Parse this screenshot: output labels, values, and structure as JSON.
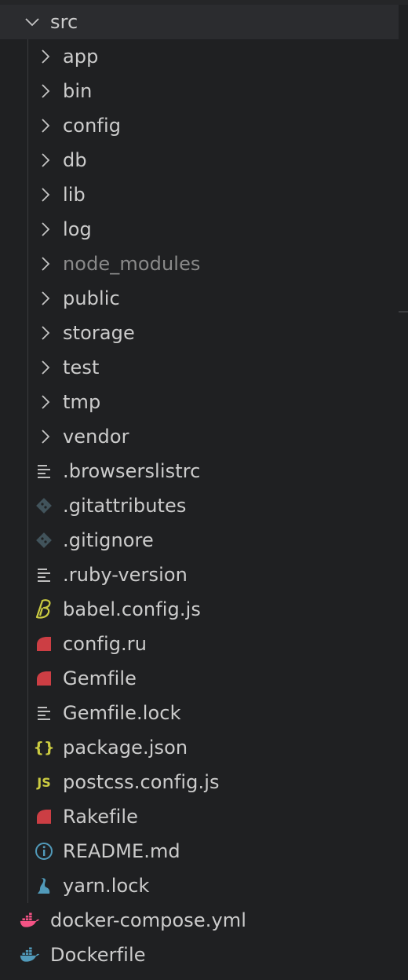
{
  "root": {
    "label": "src",
    "expanded": true
  },
  "folders": [
    {
      "label": "app",
      "dim": false
    },
    {
      "label": "bin",
      "dim": false
    },
    {
      "label": "config",
      "dim": false
    },
    {
      "label": "db",
      "dim": false
    },
    {
      "label": "lib",
      "dim": false
    },
    {
      "label": "log",
      "dim": false
    },
    {
      "label": "node_modules",
      "dim": true
    },
    {
      "label": "public",
      "dim": false
    },
    {
      "label": "storage",
      "dim": false
    },
    {
      "label": "test",
      "dim": false
    },
    {
      "label": "tmp",
      "dim": false
    },
    {
      "label": "vendor",
      "dim": false
    }
  ],
  "files": [
    {
      "label": ".browserslistrc",
      "icon": "lines-icon"
    },
    {
      "label": ".gitattributes",
      "icon": "git-icon"
    },
    {
      "label": ".gitignore",
      "icon": "git-icon"
    },
    {
      "label": ".ruby-version",
      "icon": "lines-icon"
    },
    {
      "label": "babel.config.js",
      "icon": "babel-icon"
    },
    {
      "label": "config.ru",
      "icon": "ruby-icon"
    },
    {
      "label": "Gemfile",
      "icon": "ruby-icon"
    },
    {
      "label": "Gemfile.lock",
      "icon": "lines-icon"
    },
    {
      "label": "package.json",
      "icon": "json-icon"
    },
    {
      "label": "postcss.config.js",
      "icon": "js-icon"
    },
    {
      "label": "Rakefile",
      "icon": "ruby-icon"
    },
    {
      "label": "README.md",
      "icon": "info-icon"
    },
    {
      "label": "yarn.lock",
      "icon": "yarn-icon"
    }
  ],
  "root_files": [
    {
      "label": "docker-compose.yml",
      "icon": "docker-compose-icon"
    },
    {
      "label": "Dockerfile",
      "icon": "docker-icon"
    }
  ],
  "colors": {
    "background": "#1f2022",
    "selected_row": "#2b2c2f",
    "text": "#cccccc",
    "dim_text": "#8a8a8a",
    "git": "#41535b",
    "ruby": "#cc3e44",
    "babel": "#cbcb41",
    "json": "#cbcb41",
    "js": "#cbcb41",
    "info": "#519aba",
    "yarn": "#519aba",
    "docker_compose": "#f55385",
    "docker": "#519aba"
  }
}
